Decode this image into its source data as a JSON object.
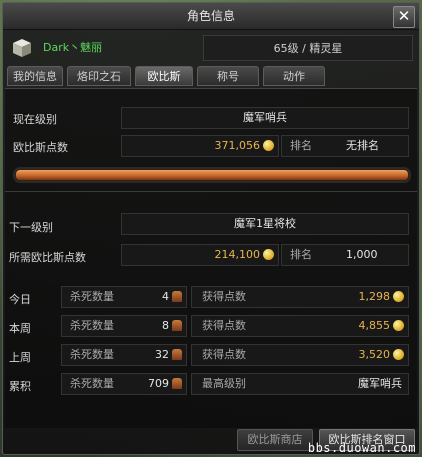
{
  "window": {
    "title": "角色信息",
    "close_label": "✕"
  },
  "player": {
    "name": "Dark丶魅丽",
    "level_class": "65级 / 精灵星"
  },
  "tabs": [
    {
      "label": "我的信息"
    },
    {
      "label": "烙印之石"
    },
    {
      "label": "欧比斯"
    },
    {
      "label": "称号"
    },
    {
      "label": "动作"
    }
  ],
  "active_tab": "欧比斯",
  "current": {
    "rank_label": "现在级别",
    "rank_value": "魔军哨兵",
    "points_label": "欧比斯点数",
    "points_value": "371,056",
    "ranking_label": "排名",
    "ranking_value": "无排名",
    "progress": 1.0
  },
  "next": {
    "rank_label": "下一级别",
    "rank_value": "魔军1星将校",
    "required_label": "所需欧比斯点数",
    "required_value": "214,100",
    "ranking_label": "排名",
    "ranking_value": "1,000"
  },
  "stats": {
    "kill_label": "杀死数量",
    "gain_label": "获得点数",
    "max_rank_label": "最高级别",
    "rows": [
      {
        "period": "今日",
        "kills": "4",
        "points": "1,298"
      },
      {
        "period": "本周",
        "kills": "8",
        "points": "4,855"
      },
      {
        "period": "上周",
        "kills": "32",
        "points": "3,520"
      },
      {
        "period": "累积",
        "kills": "709",
        "max_rank": "魔军哨兵"
      }
    ]
  },
  "buttons": {
    "orbis_shop": "欧比斯商店",
    "orbis_ranking": "欧比斯排名窗口"
  },
  "watermark": "bbs.duowan.com",
  "colors": {
    "gold": "#e7b450",
    "name_green": "#5ed65e",
    "bar": "#c0622a"
  }
}
